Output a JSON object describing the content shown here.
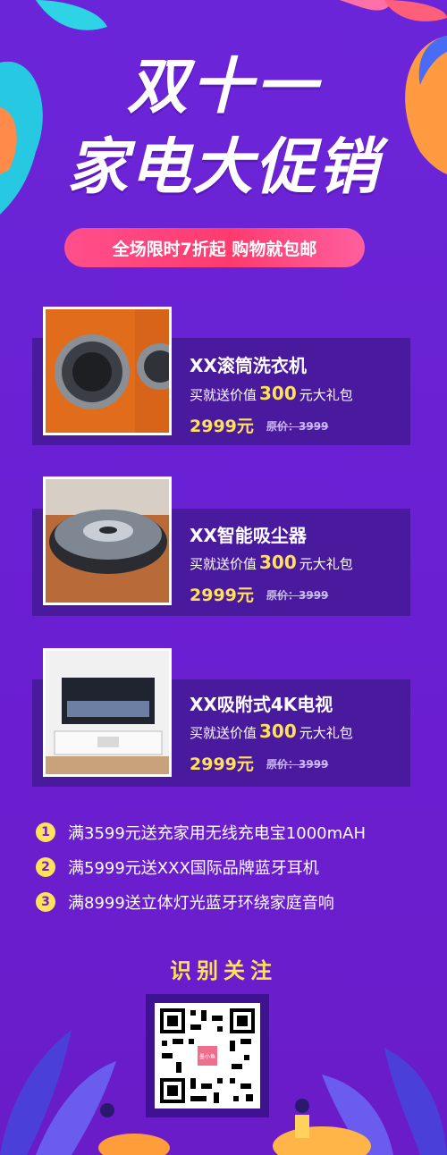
{
  "header": {
    "title_line1": "双十一",
    "title_line2": "家电大促销",
    "banner": "全场限时7折起 购物就包邮"
  },
  "products": [
    {
      "name": "XX滚筒洗衣机",
      "gift_prefix": "买就送价值",
      "gift_value": "300",
      "gift_suffix": "元大礼包",
      "price": "2999元",
      "original_price": "原价：3999",
      "image": "washing-machine-photo"
    },
    {
      "name": "XX智能吸尘器",
      "gift_prefix": "买就送价值",
      "gift_value": "300",
      "gift_suffix": "元大礼包",
      "price": "2999元",
      "original_price": "原价：3999",
      "image": "robot-vacuum-photo"
    },
    {
      "name": "XX吸附式4K电视",
      "gift_prefix": "买就送价值",
      "gift_value": "300",
      "gift_suffix": "元大礼包",
      "price": "2999元",
      "original_price": "原价：3999",
      "image": "tv-photo"
    }
  ],
  "promotions": [
    {
      "num": "1",
      "text": "满3599元送充家用无线充电宝1000mAH"
    },
    {
      "num": "2",
      "text": "满5999元送XXX国际品牌蓝牙耳机"
    },
    {
      "num": "3",
      "text": "满8999送立体灯光蓝牙环绕家庭音响"
    }
  ],
  "footer": {
    "follow_label": "识别关注",
    "qr_logo_text": "墨小鱼"
  },
  "colors": {
    "background": "#6a21d6",
    "card": "#4a1a9e",
    "accent_yellow": "#ffe25a",
    "banner_pink": "#ff4f8c"
  }
}
